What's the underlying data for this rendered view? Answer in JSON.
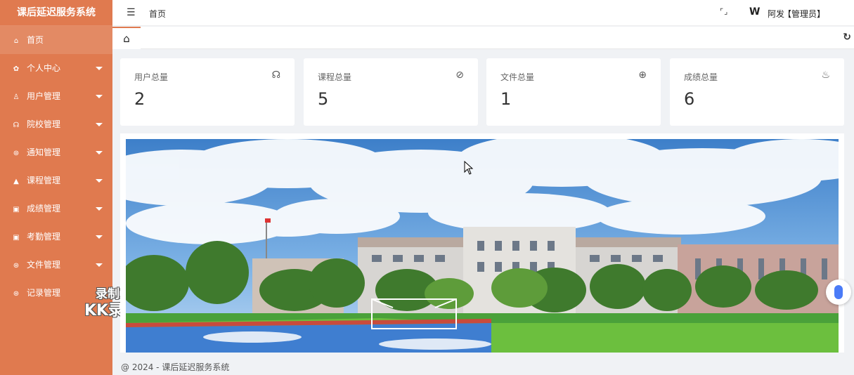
{
  "app": {
    "title": "课后延迟服务系统"
  },
  "sidebar": {
    "items": [
      {
        "label": "首页",
        "icon": "⌂"
      },
      {
        "label": "个人中心",
        "icon": "✿"
      },
      {
        "label": "用户管理",
        "icon": "♙"
      },
      {
        "label": "院校管理",
        "icon": "☊"
      },
      {
        "label": "通知管理",
        "icon": "⊛"
      },
      {
        "label": "课程管理",
        "icon": "▲"
      },
      {
        "label": "成绩管理",
        "icon": "▣"
      },
      {
        "label": "考勤管理",
        "icon": "▣"
      },
      {
        "label": "文件管理",
        "icon": "⊛"
      },
      {
        "label": "记录管理",
        "icon": "⊛"
      }
    ]
  },
  "header": {
    "title": "首页",
    "fold_icon": "☰",
    "fullscreen_icon": "⌜⌟",
    "user_logo": "W",
    "user_name": "阿发",
    "user_role": "【管理员】"
  },
  "tabs": {
    "home_icon": "⌂",
    "refresh_icon": "↻"
  },
  "stats": [
    {
      "label": "用户总量",
      "value": "2",
      "icon": "☊"
    },
    {
      "label": "课程总量",
      "value": "5",
      "icon": "⊘"
    },
    {
      "label": "文件总量",
      "value": "1",
      "icon": "⊕"
    },
    {
      "label": "成绩总量",
      "value": "6",
      "icon": "♨"
    }
  ],
  "watermark": {
    "line1": "录制工具",
    "line2": "KK录像机"
  },
  "footer": {
    "text": "@ 2024 - 课后延迟服务系统"
  },
  "colors": {
    "sidebar": "#e07a4f",
    "accent": "#e07a4f",
    "float_button": "#4a7bf7"
  }
}
